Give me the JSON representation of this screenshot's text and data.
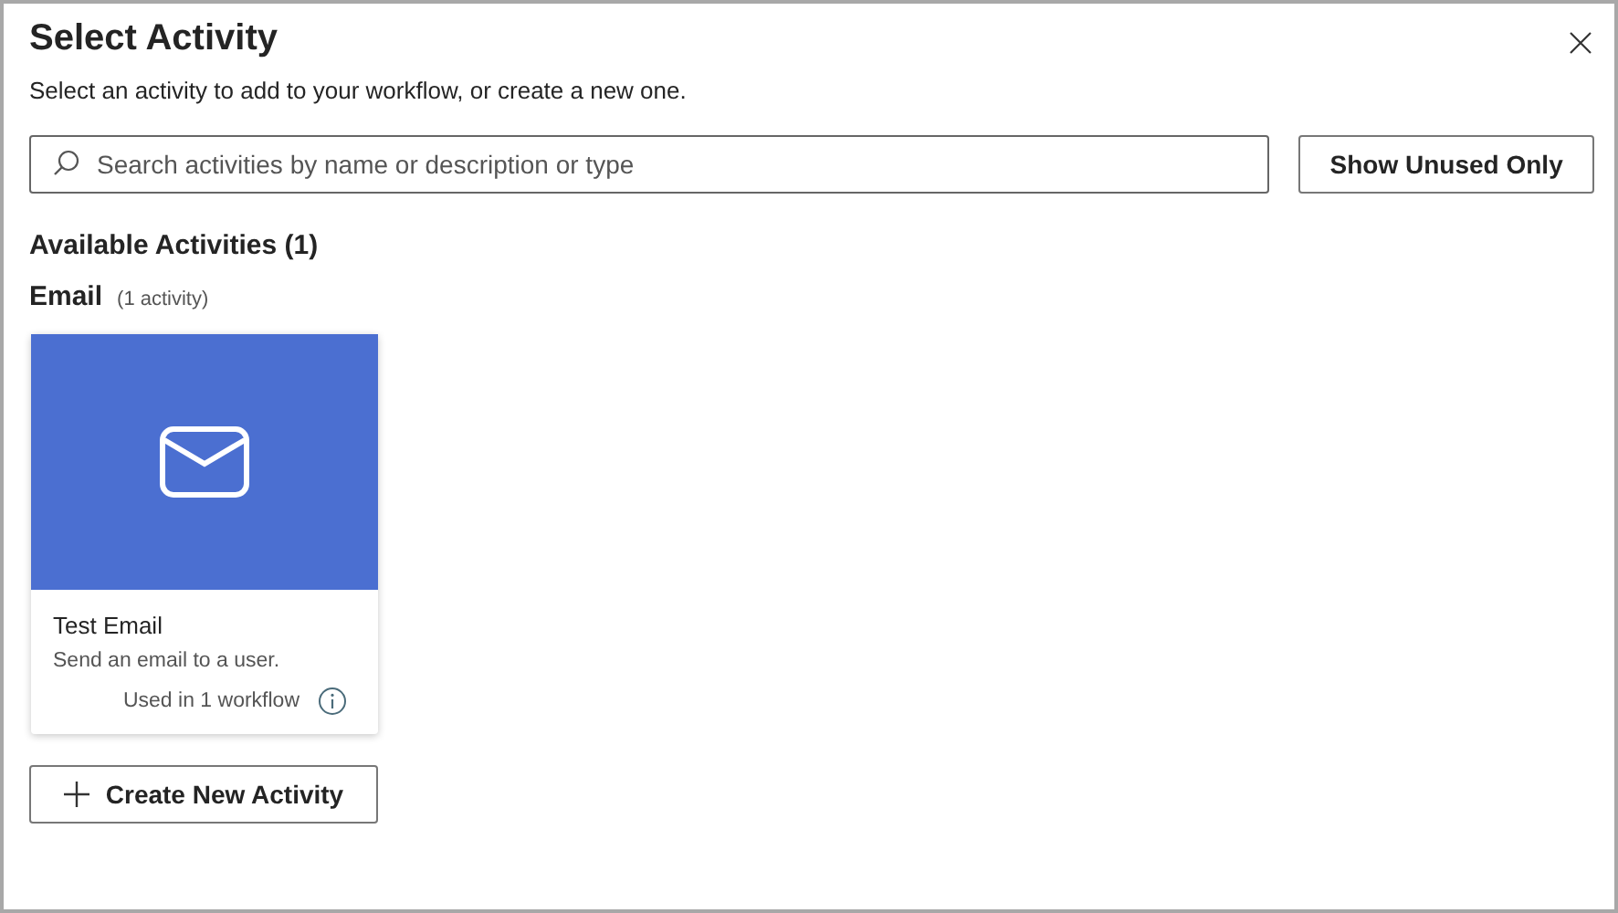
{
  "dialog": {
    "title": "Select Activity",
    "subtitle": "Select an activity to add to your workflow, or create a new one."
  },
  "search": {
    "placeholder": "Search activities by name or description or type"
  },
  "filter_button": "Show Unused Only",
  "section_title": "Available Activities (1)",
  "groups": [
    {
      "name": "Email",
      "count": "(1 activity)",
      "cards": [
        {
          "title": "Test Email",
          "description": "Send an email to a user.",
          "usage": "Used in 1 workflow",
          "color": "#4b6fd1"
        }
      ]
    }
  ],
  "create_button": "Create New Activity"
}
